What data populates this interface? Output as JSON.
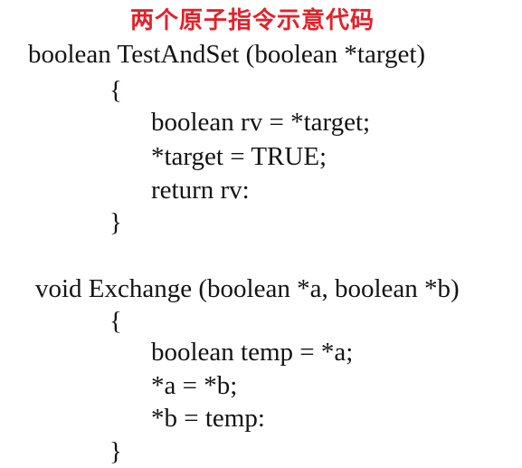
{
  "title": "两个原子指令示意代码",
  "code": {
    "lines": [
      "boolean TestAndSet (boolean *target)",
      "{",
      "boolean rv = *target;",
      "*target = TRUE;",
      "return rv:",
      "}",
      "void Exchange (boolean *a, boolean *b)",
      "{",
      "boolean temp = *a;",
      "*a = *b;",
      "*b = temp:",
      "}"
    ]
  },
  "colors": {
    "title": "#e4212a",
    "text": "#141414",
    "background": "#ffffff"
  }
}
